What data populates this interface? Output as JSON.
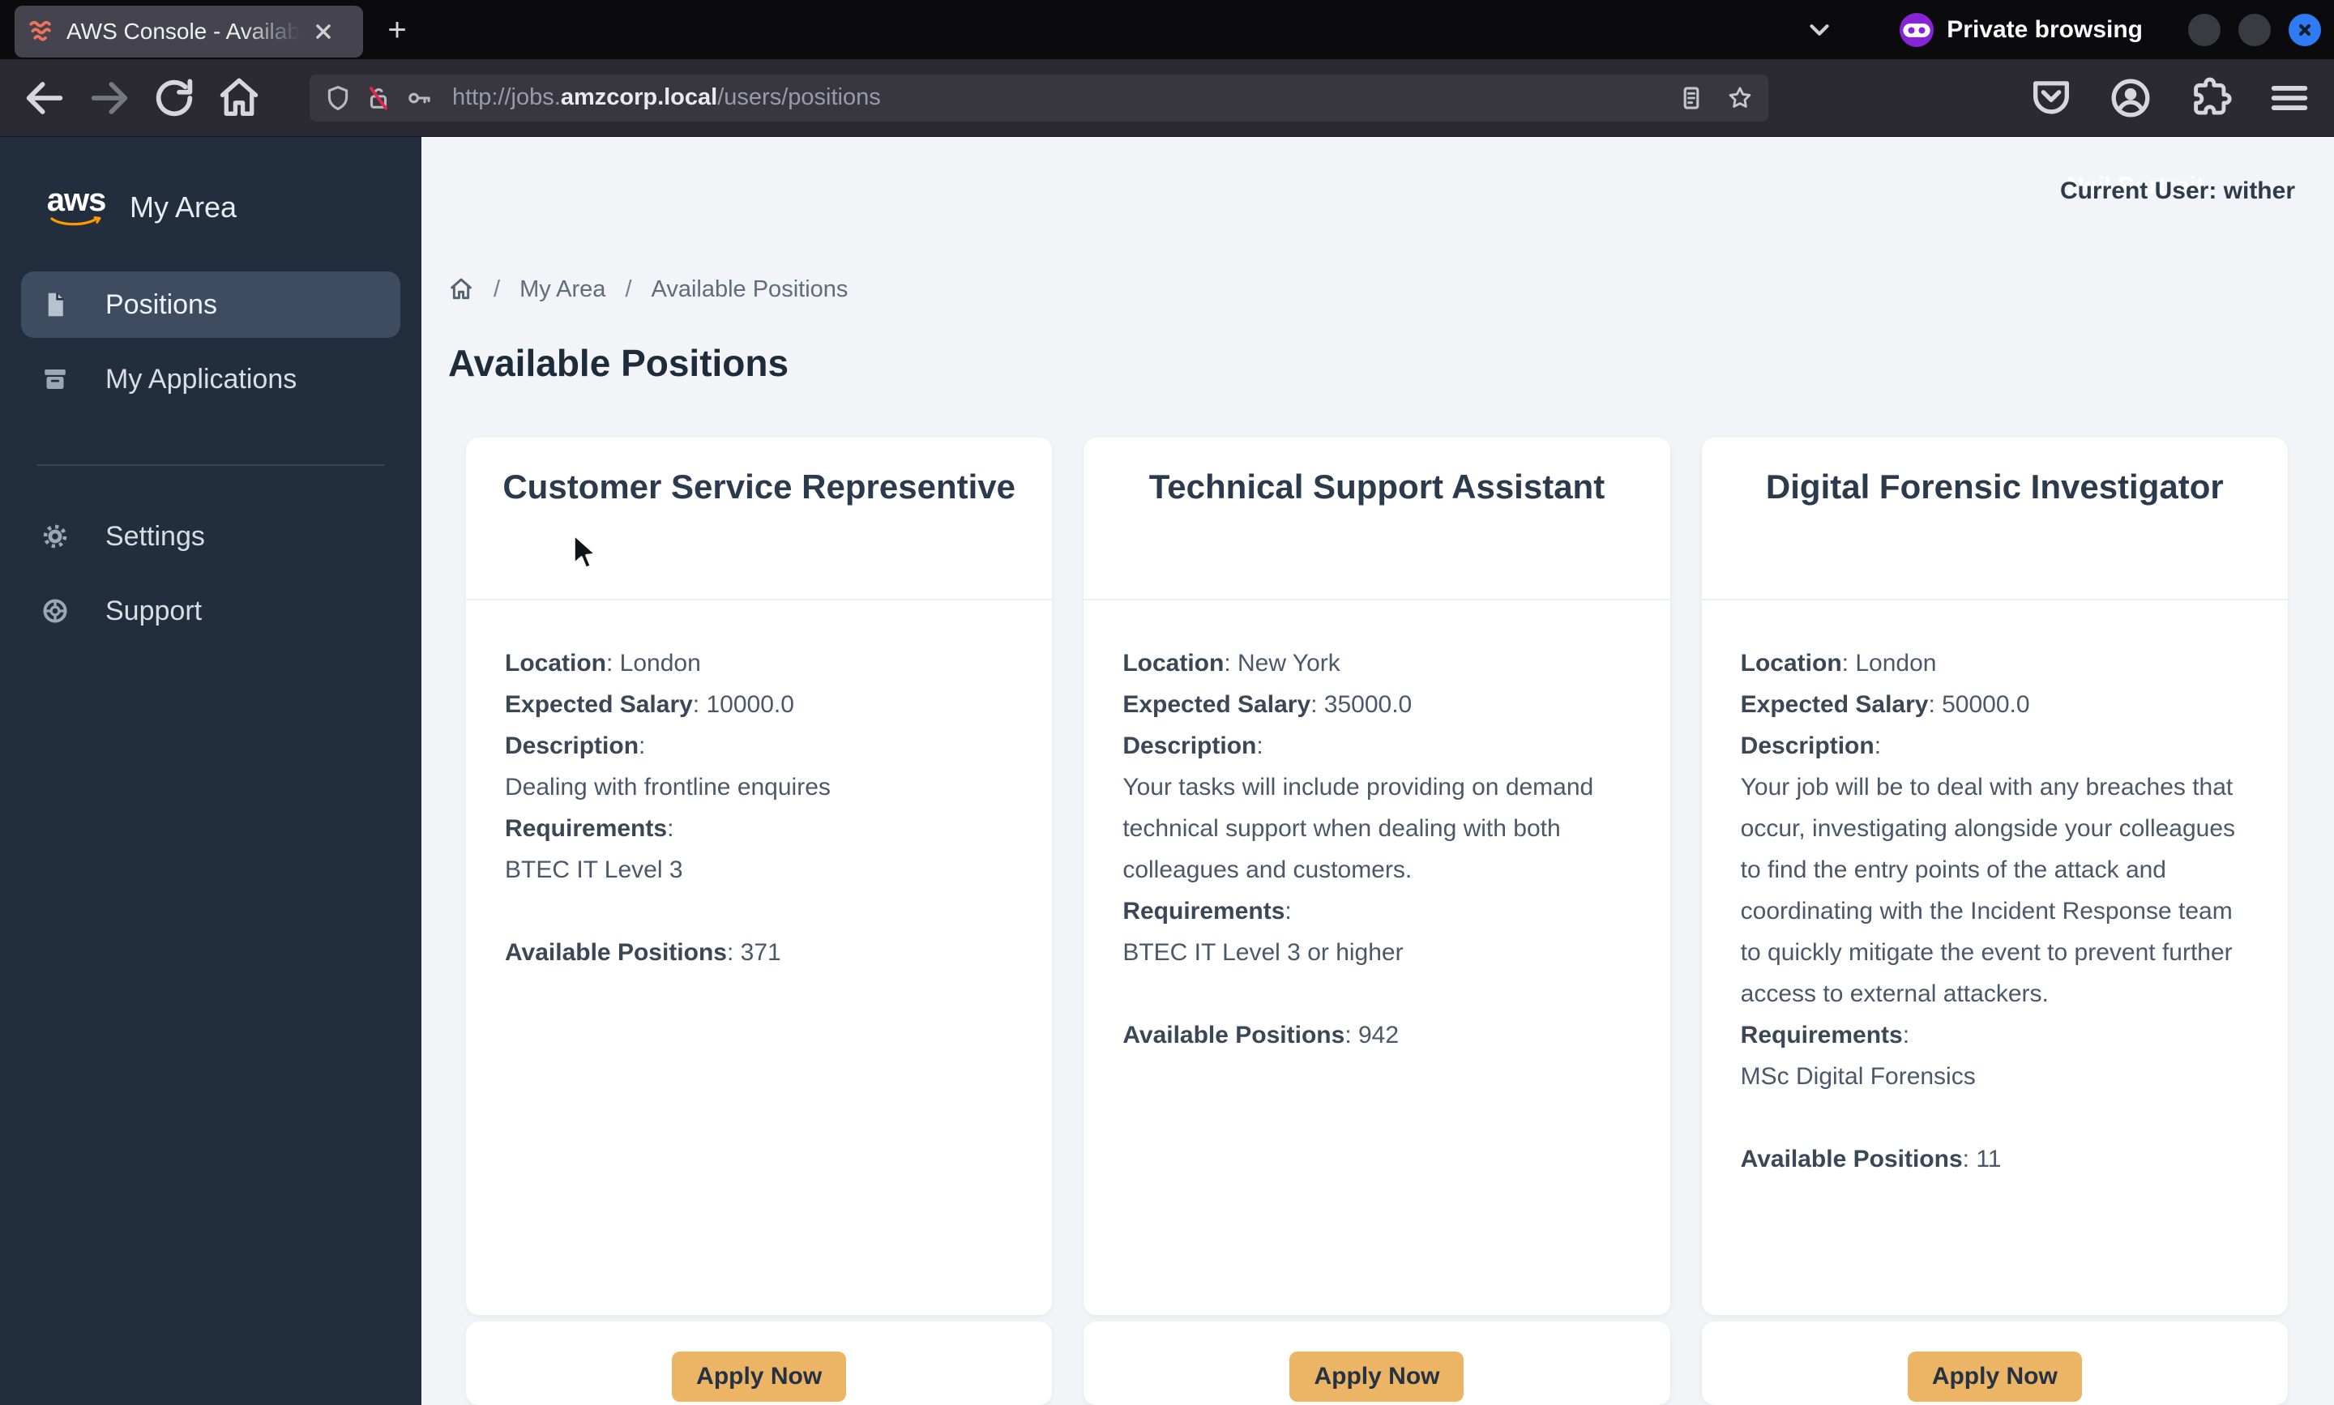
{
  "browser": {
    "tab_title": "AWS Console - Available P",
    "new_tab_glyph": "+",
    "private_label": "Private browsing",
    "url_prefix": "http://jobs.",
    "url_domain": "amzcorp.local",
    "url_path": "/users/positions"
  },
  "header": {
    "ghost_text": "Neil Portrait",
    "current_user": "Current User: wither"
  },
  "sidebar": {
    "brand_logo_text": "aws",
    "brand_label": "My Area",
    "items": [
      {
        "label": "Positions",
        "active": true
      },
      {
        "label": "My Applications",
        "active": false
      },
      {
        "label": "Settings",
        "active": false
      },
      {
        "label": "Support",
        "active": false
      }
    ]
  },
  "breadcrumb": {
    "items": [
      "My Area",
      "Available Positions"
    ]
  },
  "page": {
    "title": "Available Positions"
  },
  "labels": {
    "location": "Location",
    "salary": "Expected Salary",
    "description": "Description",
    "requirements": "Requirements",
    "available": "Available Positions"
  },
  "strings": {
    "colon": ": ",
    "slash": "/",
    "apply": "Apply Now"
  },
  "cards": [
    {
      "title": "Customer Service Representive",
      "location": "London",
      "salary": "10000.0",
      "description": "Dealing with frontline enquires",
      "requirements": "BTEC IT Level 3",
      "available": "371"
    },
    {
      "title": "Technical Support Assistant",
      "location": "New York",
      "salary": "35000.0",
      "description": "Your tasks will include providing on demand technical support when dealing with both colleagues and customers.",
      "requirements": "BTEC IT Level 3 or higher",
      "available": "942"
    },
    {
      "title": "Digital Forensic Investigator",
      "location": "London",
      "salary": "50000.0",
      "description": "Your job will be to deal with any breaches that occur, investigating alongside your colleagues to find the entry points of the attack and coordinating with the Incident Response team to quickly mitigate the event to prevent further access to external attackers.",
      "requirements": "MSc Digital Forensics",
      "available": "11"
    }
  ],
  "colors": {
    "apply_button": "#ecb465",
    "aws_orange": "#ff9900",
    "favicon_coral": "#f2715c",
    "private_purple": "#8724d8",
    "close_button_blue": "#2f7bf5",
    "sidebar_bg": "#222e3d",
    "content_bg": "#f2f4f7"
  }
}
